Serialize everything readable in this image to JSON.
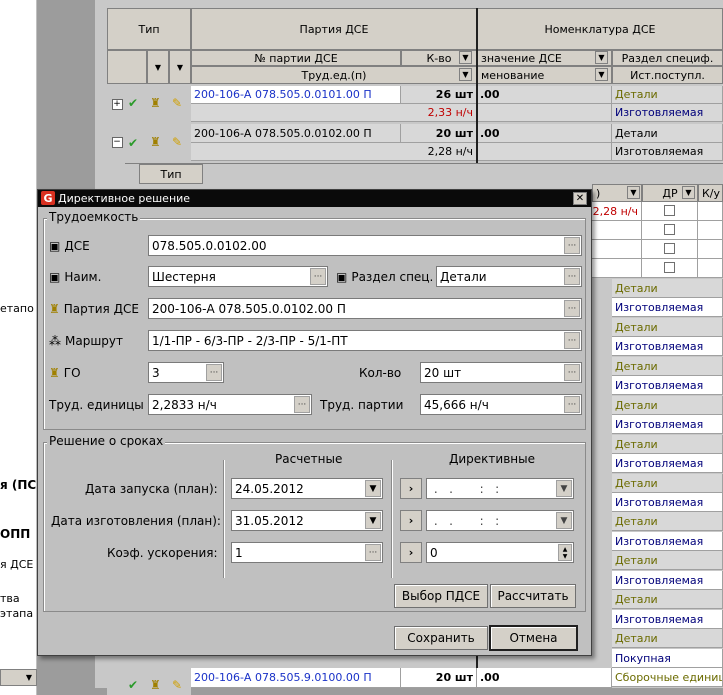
{
  "left_pane": {
    "texts": [
      "етапо",
      "я (ПС",
      "ОПП",
      "я ДСЕ",
      "тва",
      "этапа"
    ]
  },
  "grid": {
    "header": {
      "type": "Тип",
      "batch_group": "Партия ДСЕ",
      "nomenclature_group": "Номенклатура ДСЕ",
      "batch_no": "№ партии ДСЕ",
      "qty": "К-во",
      "designation": "значение ДСЕ",
      "section": "Раздел специф.",
      "labor": "Труд.ед.(п)",
      "name": "менование",
      "source": "Ист.поступл."
    },
    "rows": [
      {
        "batch": "200-106-А 078.505.0.0101.00 П",
        "qty": "26 шт",
        "dse": ".00",
        "labor": "2,33 н/ч",
        "section": "Детали",
        "source": "Изготовляемая",
        "expand": "+"
      },
      {
        "batch": "200-106-А 078.505.0.0102.00 П",
        "qty": "20 шт",
        "dse": ".00",
        "labor": "2,28 н/ч",
        "section": "Детали",
        "source": "Изготовляемая",
        "expand": "−"
      }
    ],
    "subgrid": {
      "type": "Тип",
      "col_paren": ")",
      "dr": "ДР",
      "ku": "К/у",
      "labor": "2,28 н/ч"
    },
    "right_column": [
      "Детали",
      "Изготовляемая",
      "Детали",
      "Изготовляемая",
      "Детали",
      "Изготовляемая",
      "Детали",
      "Изготовляемая",
      "Детали",
      "Изготовляемая",
      "Детали",
      "Изготовляемая",
      "Детали",
      "Изготовляемая",
      "Детали",
      "Изготовляемая",
      "Детали",
      "Изготовляемая",
      "Детали",
      "Покупная",
      "Сборочные единиц"
    ],
    "last_row": {
      "batch": "200-106-А 078.505.9.0100.00 П",
      "qty": "20 шт",
      "dse": ".00"
    }
  },
  "dialog": {
    "title": "Директивное решение",
    "labor_group": "Трудоемкость",
    "dse_label": "ДСЕ",
    "dse_value": "078.505.0.0102.00",
    "name_label": "Наим.",
    "name_value": "Шестерня",
    "section_label": "Раздел спец.",
    "section_value": "Детали",
    "batch_label": "Партия ДСЕ",
    "batch_value": "200-106-А 078.505.0.0102.00 П",
    "route_label": "Маршрут",
    "route_value": "1/1-ПР - 6/3-ПР - 2/3-ПР - 5/1-ПТ",
    "go_label": "ГО",
    "go_value": "3",
    "qty_label": "Кол-во",
    "qty_value": "20 шт",
    "unit_labor_label": "Труд. единицы",
    "unit_labor_value": "2,2833 н/ч",
    "batch_labor_label": "Труд. партии",
    "batch_labor_value": "45,666 н/ч",
    "deadline_group": "Решение о сроках",
    "calc_header": "Расчетные",
    "directive_header": "Директивные",
    "start_label": "Дата запуска (план):",
    "start_calc": "24.05.2012",
    "start_dir": " .   .       :   :",
    "make_label": "Дата изготовления (план):",
    "make_calc": "31.05.2012",
    "make_dir": " .   .       :   :",
    "accel_label": "Коэф. ускорения:",
    "accel_calc": "1",
    "accel_dir": "0",
    "select_btn": "Выбор ПДСЕ",
    "calc_btn": "Рассчитать",
    "save_btn": "Сохранить",
    "cancel_btn": "Отмена"
  }
}
